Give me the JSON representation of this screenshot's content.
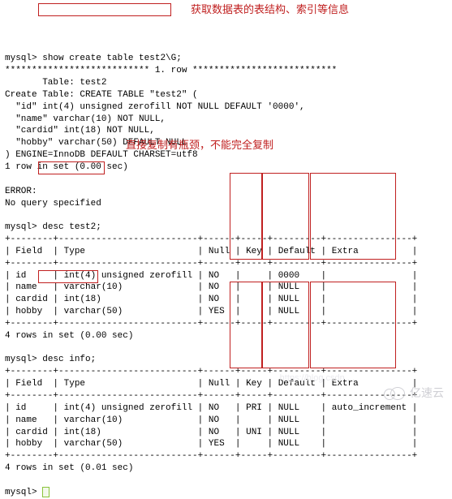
{
  "prompt": "mysql>",
  "commands": {
    "show_create": "show create table test2\\G;",
    "desc_test2": "desc test2;",
    "desc_info": "desc info;"
  },
  "annotations": {
    "top": "获取数据表的表结构、索引等信息",
    "middle": "直接复制有瓶颈，不能完全复制"
  },
  "show_create_result": {
    "row_header": "*************************** 1. row ***************************",
    "table_line": "       Table: test2",
    "create_line": "Create Table: CREATE TABLE \"test2\" (",
    "col1": "  \"id\" int(4) unsigned zerofill NOT NULL DEFAULT '0000',",
    "col2": "  \"name\" varchar(10) NOT NULL,",
    "col3": "  \"cardid\" int(18) NOT NULL,",
    "col4": "  \"hobby\" varchar(50) DEFAULT NULL",
    "engine": ") ENGINE=InnoDB DEFAULT CHARSET=utf8",
    "rows": "1 row in set (0.00 sec)"
  },
  "error": {
    "l1": "ERROR:",
    "l2": "No query specified"
  },
  "desc_headers": {
    "field": "Field",
    "type": "Type",
    "null": "Null",
    "key": "Key",
    "default": "Default",
    "extra": "Extra"
  },
  "desc_test2_rows": [
    {
      "field": "id",
      "type": "int(4) unsigned zerofill",
      "null": "NO",
      "key": "",
      "default": "0000",
      "extra": ""
    },
    {
      "field": "name",
      "type": "varchar(10)",
      "null": "NO",
      "key": "",
      "default": "NULL",
      "extra": ""
    },
    {
      "field": "cardid",
      "type": "int(18)",
      "null": "NO",
      "key": "",
      "default": "NULL",
      "extra": ""
    },
    {
      "field": "hobby",
      "type": "varchar(50)",
      "null": "YES",
      "key": "",
      "default": "NULL",
      "extra": ""
    }
  ],
  "desc_test2_footer": "4 rows in set (0.00 sec)",
  "desc_info_rows": [
    {
      "field": "id",
      "type": "int(4) unsigned zerofill",
      "null": "NO",
      "key": "PRI",
      "default": "NULL",
      "extra": "auto_increment"
    },
    {
      "field": "name",
      "type": "varchar(10)",
      "null": "NO",
      "key": "",
      "default": "NULL",
      "extra": ""
    },
    {
      "field": "cardid",
      "type": "int(18)",
      "null": "NO",
      "key": "UNI",
      "default": "NULL",
      "extra": ""
    },
    {
      "field": "hobby",
      "type": "varchar(50)",
      "null": "YES",
      "key": "",
      "default": "NULL",
      "extra": ""
    }
  ],
  "desc_info_footer": "4 rows in set (0.01 sec)",
  "table_sep": "+--------+--------------------------+------+-----+---------+----------------+",
  "watermark": "亿速云",
  "watermark_url": "https://blog.csdn...."
}
